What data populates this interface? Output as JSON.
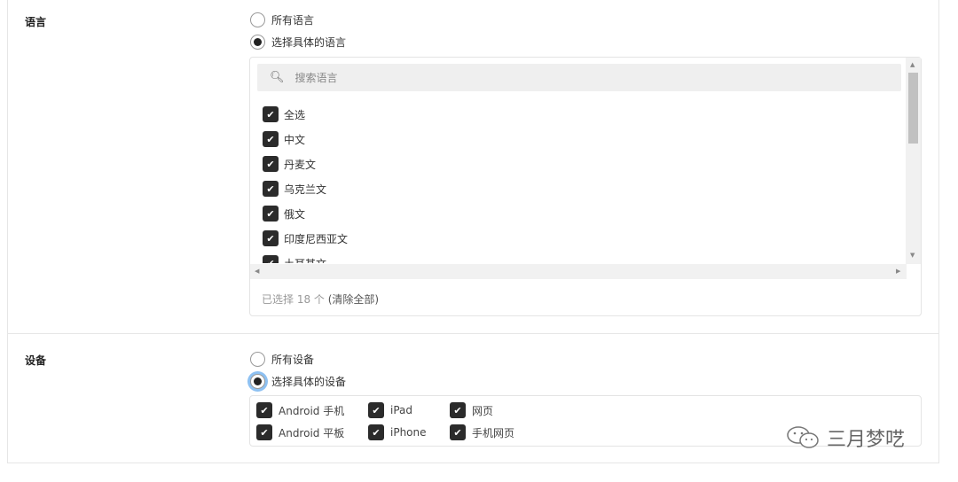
{
  "language": {
    "label": "语言",
    "radio_all": "所有语言",
    "radio_specific": "选择具体的语言",
    "selected_option": "specific",
    "search_placeholder": "搜索语言",
    "items": [
      "全选",
      "中文",
      "丹麦文",
      "乌克兰文",
      "俄文",
      "印度尼西亚文",
      "土耳其文"
    ],
    "selected_count_text": "已选择 18 个",
    "clear_all": "(清除全部)"
  },
  "device": {
    "label": "设备",
    "radio_all": "所有设备",
    "radio_specific": "选择具体的设备",
    "selected_option": "specific",
    "items": [
      "Android 手机",
      "Android 平板",
      "iPad",
      "iPhone",
      "网页",
      "手机网页"
    ]
  },
  "watermark": {
    "text": "三月梦呓",
    "icon": "wechat-icon"
  }
}
